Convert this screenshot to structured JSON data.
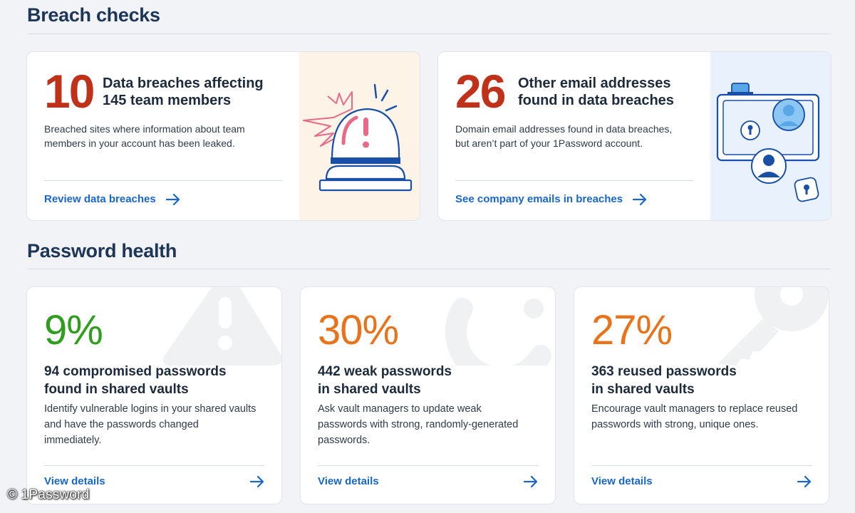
{
  "breach_section": {
    "title": "Breach checks",
    "cards": [
      {
        "number": "10",
        "headline": "Data breaches affecting\n145 team members",
        "description": "Breached sites where information about team\nmembers in your account has been leaked.",
        "link_label": "Review data breaches",
        "illustration": "alarm-siren-icon",
        "panel_color": "#fdf3e6"
      },
      {
        "number": "26",
        "headline": "Other email addresses\nfound in data breaches",
        "description": "Domain email addresses found in data breaches,\nbut aren’t part of your 1Password account.",
        "link_label": "See company emails in breaches",
        "illustration": "monitor-users-icon",
        "panel_color": "#e8f1fc"
      }
    ]
  },
  "health_section": {
    "title": "Password health",
    "cards": [
      {
        "percent": "9%",
        "percent_color": "#2f9e1f",
        "title": "94 compromised passwords\nfound in shared vaults",
        "description": "Identify vulnerable logins in your shared vaults and have the passwords changed immediately.",
        "link_label": "View details",
        "bg_icon": "warning-icon"
      },
      {
        "percent": "30%",
        "percent_color": "#e8731a",
        "title": "442 weak passwords\nin shared vaults",
        "description": "Ask vault managers to update weak passwords with strong, randomly-generated passwords.",
        "link_label": "View details",
        "bg_icon": "gauge-icon"
      },
      {
        "percent": "27%",
        "percent_color": "#e8731a",
        "title": "363 reused passwords\nin shared vaults",
        "description": "Encourage vault managers to replace reused passwords with strong, unique ones.",
        "link_label": "View details",
        "bg_icon": "key-icon"
      }
    ]
  },
  "watermark": "© 1Password",
  "colors": {
    "accent_link": "#1a66c9",
    "breach_number": "#c0311a",
    "heading": "#1d3557"
  }
}
